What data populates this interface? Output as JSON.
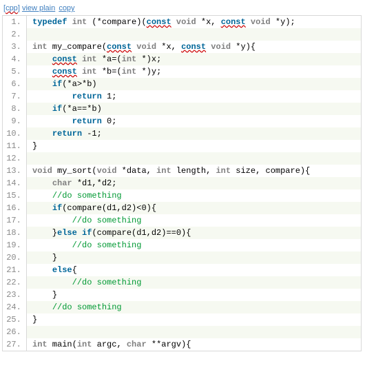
{
  "toolbar": {
    "lang": "cpp",
    "view": "view plain",
    "copy": "copy"
  },
  "code": {
    "l1": {
      "kw1": "typedef",
      "sp1": " ",
      "ty1": "int",
      "sp2": " (*compare)(",
      "kw2": "const",
      "sp3": " ",
      "ty2": "void",
      "mid": " *x, ",
      "kw3": "const",
      "sp4": " ",
      "ty3": "void",
      "tail": " *y);"
    },
    "l2": {
      "text": ""
    },
    "l3": {
      "lead": "",
      "ty1": "int",
      "sp1": " my_compare(",
      "kw1": "const",
      "sp2": " ",
      "ty2": "void",
      "mid": " *x, ",
      "kw2": "const",
      "sp3": " ",
      "ty3": "void",
      "tail": " *y){"
    },
    "l4": {
      "lead": "    ",
      "kw1": "const",
      "sp1": " ",
      "ty1": "int",
      "mid": " *a=(",
      "ty2": "int",
      "tail": " *)x;"
    },
    "l5": {
      "lead": "    ",
      "kw1": "const",
      "sp1": " ",
      "ty1": "int",
      "mid": " *b=(",
      "ty2": "int",
      "tail": " *)y;"
    },
    "l6": {
      "lead": "    ",
      "kw1": "if",
      "tail": "(*a>*b)"
    },
    "l7": {
      "lead": "        ",
      "kw1": "return",
      "tail": " 1;"
    },
    "l8": {
      "lead": "    ",
      "kw1": "if",
      "tail": "(*a==*b)"
    },
    "l9": {
      "lead": "        ",
      "kw1": "return",
      "tail": " 0;"
    },
    "l10": {
      "lead": "    ",
      "kw1": "return",
      "tail": " -1;"
    },
    "l11": {
      "text": "}"
    },
    "l12": {
      "text": ""
    },
    "l13": {
      "lead": "",
      "ty1": "void",
      "sp1": " my_sort(",
      "ty2": "void",
      "mid1": " *data, ",
      "ty3": "int",
      "mid2": " length, ",
      "ty4": "int",
      "tail": " size, compare){"
    },
    "l14": {
      "lead": "    ",
      "ty1": "char",
      "tail": " *d1,*d2;"
    },
    "l15": {
      "lead": "    ",
      "cm": "//do something"
    },
    "l16": {
      "lead": "    ",
      "kw1": "if",
      "tail": "(compare(d1,d2)<0){"
    },
    "l17": {
      "lead": "        ",
      "cm": "//do something"
    },
    "l18": {
      "lead": "    }",
      "kw1": "else",
      "sp1": " ",
      "kw2": "if",
      "tail": "(compare(d1,d2)==0){"
    },
    "l19": {
      "lead": "        ",
      "cm": "//do something"
    },
    "l20": {
      "lead": "    ",
      "text": "}"
    },
    "l21": {
      "lead": "    ",
      "kw1": "else",
      "tail": "{"
    },
    "l22": {
      "lead": "        ",
      "cm": "//do something"
    },
    "l23": {
      "lead": "    ",
      "text": "}"
    },
    "l24": {
      "lead": "    ",
      "cm": "//do something"
    },
    "l25": {
      "text": "}"
    },
    "l26": {
      "text": ""
    },
    "l27": {
      "lead": "",
      "ty1": "int",
      "sp1": " main(",
      "ty2": "int",
      "mid": " argc, ",
      "ty3": "char",
      "tail": " **argv){"
    }
  }
}
